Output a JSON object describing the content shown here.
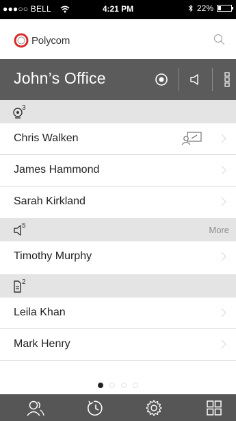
{
  "status_bar": {
    "carrier": "●●●○○ BELL",
    "time": "4:21 PM",
    "battery_percent": "22%",
    "battery_level": 0.22
  },
  "app": {
    "logo_text": "Polycom",
    "brand_color": "#d62b2b",
    "search_icon": "search-icon"
  },
  "room": {
    "title": "John’s Office",
    "controls": [
      "record-icon",
      "speaker-icon",
      "more-vertical-icon"
    ]
  },
  "sections": [
    {
      "icon": "video-participants-icon",
      "count": "3",
      "items": [
        {
          "name": "Chris Walken",
          "sharing": true
        },
        {
          "name": "James Hammond"
        },
        {
          "name": "Sarah Kirkland"
        }
      ]
    },
    {
      "icon": "audio-participants-icon",
      "count": "5",
      "more_label": "More",
      "items": [
        {
          "name": "Timothy Murphy"
        }
      ]
    },
    {
      "icon": "content-participants-icon",
      "count": "2",
      "items": [
        {
          "name": "Leila Khan"
        },
        {
          "name": "Mark Henry"
        }
      ]
    }
  ],
  "pager": {
    "total": 4,
    "active": 0
  },
  "tabbar": {
    "items": [
      "contacts-icon",
      "recents-icon",
      "settings-icon",
      "grid-icon"
    ]
  }
}
